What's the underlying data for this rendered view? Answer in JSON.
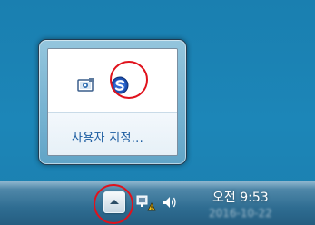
{
  "overflow_popup": {
    "customize_label": "사용자 지정...",
    "icons": [
      {
        "name": "scanner-app-icon"
      },
      {
        "name": "scansnap-manager-icon"
      }
    ]
  },
  "taskbar": {
    "show_hidden_icons_glyph": "▲",
    "clock": {
      "time": "오전 9:53",
      "date": "2016-10-22"
    }
  },
  "colors": {
    "desktop": "#1b80b2",
    "highlight": "#e0121c",
    "link": "#1a5ba0"
  }
}
